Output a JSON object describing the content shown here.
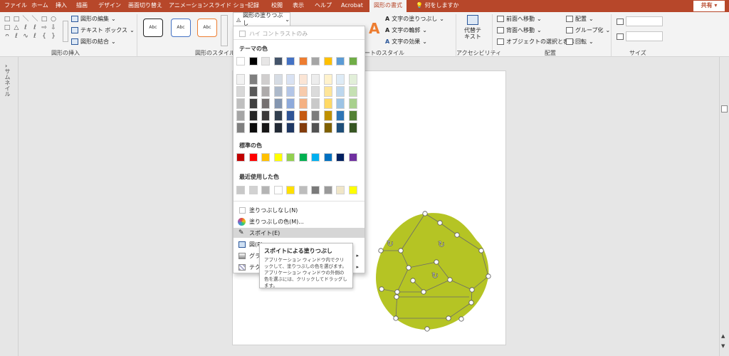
{
  "tabs": [
    "ファイル",
    "ホーム",
    "挿入",
    "描画",
    "デザイン",
    "画面切り替え",
    "アニメーション",
    "スライド ショー",
    "記録",
    "校閲",
    "表示",
    "ヘルプ",
    "Acrobat",
    "図形の書式"
  ],
  "tell_me": "何をしますか",
  "share_label": "共有",
  "ribbon": {
    "insert_shapes": {
      "label": "図形の挿入",
      "edit_shape": "図形の編集",
      "text_box": "テキスト ボックス",
      "merge_shapes": "図形の結合",
      "shape_glyphs": [
        "□",
        "□",
        "＼",
        "＼",
        "□",
        "○",
        "□",
        "△",
        "ℓ",
        "ℓ",
        "⇨",
        "⇩",
        "ᴖ",
        "ℓ",
        "∿",
        "ℓ",
        "{",
        "}"
      ]
    },
    "shape_styles": {
      "label": "図形のスタイル",
      "samples": [
        "Abc",
        "Abc",
        "Abc"
      ],
      "fill_button": "図形の塗りつぶし"
    },
    "wordart": {
      "label": "ワードアートのスタイル",
      "text_fill": "文字の塗りつぶし",
      "text_outline": "文字の輪郭",
      "text_effects": "文字の効果"
    },
    "accessibility": {
      "label": "アクセシビリティ",
      "alt_text": "代替テキスト"
    },
    "arrange": {
      "label": "配置",
      "bring_forward": "前面へ移動",
      "send_backward": "背面へ移動",
      "selection_pane": "オブジェクトの選択と表示",
      "align": "配置",
      "group": "グループ化",
      "rotate": "回転"
    },
    "size": {
      "label": "サイズ"
    }
  },
  "thumbnail_label": "サムネイル",
  "dropdown": {
    "high_contrast": "ハイ コントラストのみ",
    "theme_colors_label": "テーマの色",
    "standard_colors_label": "標準の色",
    "recent_colors_label": "最近使用した色",
    "no_fill": "塗りつぶしなし(N)",
    "more_colors": "塗りつぶしの色(M)...",
    "eyedropper": "スポイト(E)",
    "picture": "図(P)...",
    "gradient": "グラデーション(G)",
    "texture": "テクスチャ(T)",
    "theme_top": [
      "#ffffff",
      "#000000",
      "#e7e6e6",
      "#44546a",
      "#4472c4",
      "#ed7d31",
      "#a5a5a5",
      "#ffc000",
      "#5b9bd5",
      "#70ad47"
    ],
    "theme_shades": [
      [
        "#f2f2f2",
        "#7f7f7f",
        "#d0cece",
        "#d6dce4",
        "#d9e2f3",
        "#fbe5d5",
        "#ededed",
        "#fff2cc",
        "#deebf6",
        "#e2efd9"
      ],
      [
        "#d8d8d8",
        "#595959",
        "#aeabab",
        "#adb9ca",
        "#b4c6e7",
        "#f7cbac",
        "#dbdbdb",
        "#fee599",
        "#bdd7ee",
        "#c5e0b3"
      ],
      [
        "#bfbfbf",
        "#3f3f3f",
        "#757070",
        "#8496b0",
        "#8eaadb",
        "#f4b183",
        "#c9c9c9",
        "#ffd965",
        "#9cc3e5",
        "#a8d08d"
      ],
      [
        "#a5a5a5",
        "#262626",
        "#3a3838",
        "#323f4f",
        "#2f5496",
        "#c55a11",
        "#7b7b7b",
        "#bf9000",
        "#2e75b5",
        "#538135"
      ],
      [
        "#7f7f7f",
        "#0c0c0c",
        "#171616",
        "#222a35",
        "#1f3864",
        "#833c0b",
        "#525252",
        "#7f6000",
        "#1e4e79",
        "#375623"
      ]
    ],
    "standard": [
      "#c00000",
      "#ff0000",
      "#ffc000",
      "#ffff00",
      "#92d050",
      "#00b050",
      "#00b0f0",
      "#0070c0",
      "#002060",
      "#7030a0"
    ],
    "recent": [
      "#c8c8c8",
      "#d2d2d2",
      "#b4b4b4",
      "#ffffff",
      "#ffe000",
      "#bdbdbd",
      "#7a7a7a",
      "#9a9a9a",
      "#f0e6c8",
      "#ffff00"
    ]
  },
  "tooltip": {
    "title": "スポイトによる塗りつぶし",
    "body": "アプリケーション ウィンドウ内でクリックして、塗りつぶしの色を選びます。アプリケーション ウィンドウの外側の色を選ぶには、クリックしてドラッグします。"
  },
  "shape_fill_color": "#b5c424",
  "accent_color": "#b7472a"
}
